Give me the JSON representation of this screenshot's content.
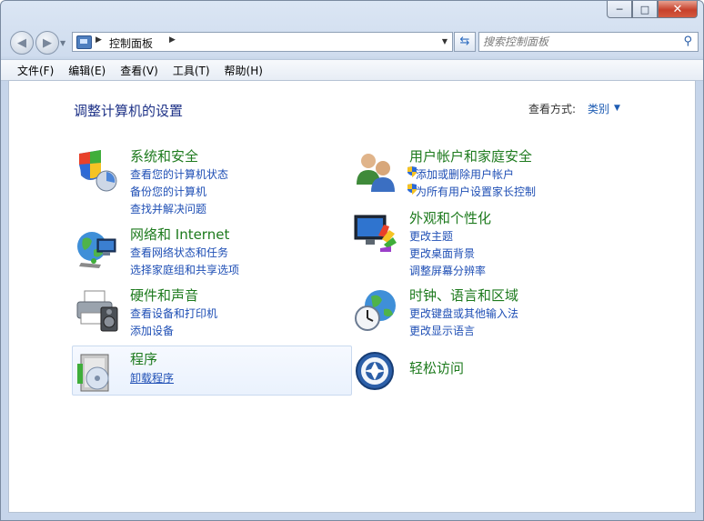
{
  "window": {
    "caption": {
      "minimize": "─",
      "maximize": "□",
      "close": "✕"
    }
  },
  "nav": {
    "back_icon": "back-arrow-icon",
    "forward_icon": "forward-arrow-icon",
    "address_crumb": "控制面板",
    "search_placeholder": "搜索控制面板"
  },
  "menu": [
    "文件(F)",
    "编辑(E)",
    "查看(V)",
    "工具(T)",
    "帮助(H)"
  ],
  "main": {
    "title": "调整计算机的设置",
    "view_by_label": "查看方式:",
    "view_by_value": "类别",
    "categories": [
      {
        "title": "系统和安全",
        "links": [
          "查看您的计算机状态",
          "备份您的计算机",
          "查找并解决问题"
        ]
      },
      {
        "title": "网络和 Internet",
        "links": [
          "查看网络状态和任务",
          "选择家庭组和共享选项"
        ]
      },
      {
        "title": "硬件和声音",
        "links": [
          "查看设备和打印机",
          "添加设备"
        ]
      },
      {
        "title": "程序",
        "links": [
          "卸载程序"
        ]
      },
      {
        "title": "用户帐户和家庭安全",
        "links": [
          "添加或删除用户帐户",
          "为所有用户设置家长控制"
        ]
      },
      {
        "title": "外观和个性化",
        "links": [
          "更改主题",
          "更改桌面背景",
          "调整屏幕分辨率"
        ]
      },
      {
        "title": "时钟、语言和区域",
        "links": [
          "更改键盘或其他输入法",
          "更改显示语言"
        ]
      },
      {
        "title": "轻松访问",
        "links": []
      }
    ]
  }
}
